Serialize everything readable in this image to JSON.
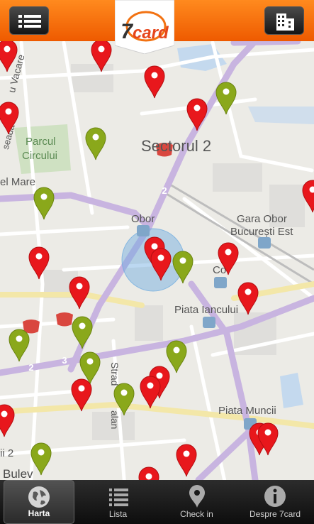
{
  "header": {
    "menu_icon": "list-icon",
    "logo_seven": "7",
    "logo_word": "card",
    "buildings_icon": "buildings-icon"
  },
  "map": {
    "labels": {
      "sector": "Sectorul 2",
      "parc": "Parcul",
      "circului": "Circului",
      "el_mare": "el Mare",
      "obor": "Obor",
      "gara": "Gara Obor",
      "bucuresti": "București Est",
      "co": "Co",
      "piata_iancului": "Piata Iancului",
      "piata_muncii": "Piata Muncii",
      "strad": "Strad",
      "alan": "alan",
      "ii2": "ii 2",
      "bulev": "Bulev",
      "vacare": "u Vacare",
      "seada": "seada"
    },
    "shields": [
      "2",
      "2",
      "3"
    ],
    "colors": {
      "red_pin": "#e8171c",
      "green_pin": "#8aa81b",
      "accent": "#f27212"
    }
  },
  "nav": {
    "items": [
      {
        "label": "Harta",
        "icon": "globe-icon",
        "active": true
      },
      {
        "label": "Lista",
        "icon": "list-icon",
        "active": false
      },
      {
        "label": "Check in",
        "icon": "location-pin-icon",
        "active": false
      },
      {
        "label": "Despre 7card",
        "icon": "info-icon",
        "active": false
      }
    ]
  }
}
